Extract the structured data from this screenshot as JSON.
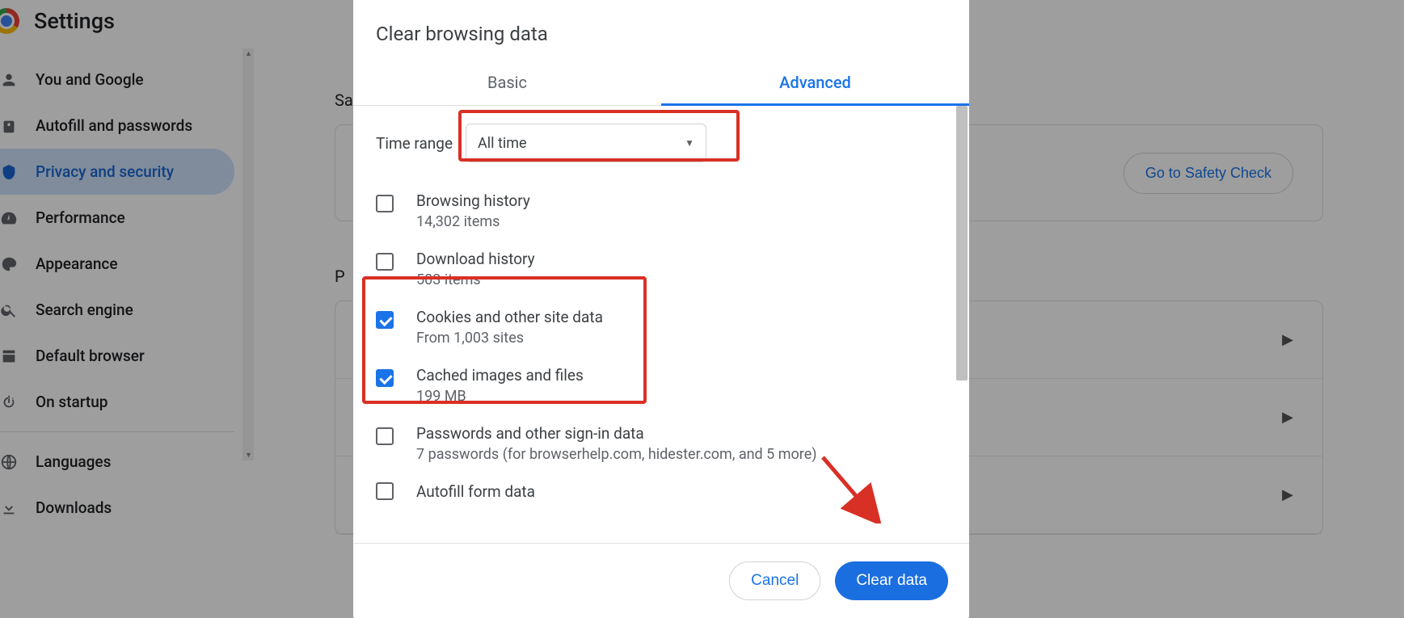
{
  "settings_title": "Settings",
  "sidebar": {
    "items": [
      {
        "icon": "person",
        "label": "You and Google"
      },
      {
        "icon": "key",
        "label": "Autofill and passwords"
      },
      {
        "icon": "shield",
        "label": "Privacy and security"
      },
      {
        "icon": "speed",
        "label": "Performance"
      },
      {
        "icon": "palette",
        "label": "Appearance"
      },
      {
        "icon": "search",
        "label": "Search engine"
      },
      {
        "icon": "window",
        "label": "Default browser"
      },
      {
        "icon": "power",
        "label": "On startup"
      },
      {
        "icon": "globe",
        "label": "Languages"
      },
      {
        "icon": "download",
        "label": "Downloads"
      }
    ],
    "active_index": 2
  },
  "bg": {
    "section1": "Sa",
    "safety_button": "Go to Safety Check",
    "section2": "P"
  },
  "dialog": {
    "title": "Clear browsing data",
    "tabs": [
      "Basic",
      "Advanced"
    ],
    "active_tab": 1,
    "time_label": "Time range",
    "time_value": "All time",
    "options": [
      {
        "title": "Browsing history",
        "sub": "14,302 items",
        "checked": false
      },
      {
        "title": "Download history",
        "sub": "503 items",
        "checked": false
      },
      {
        "title": "Cookies and other site data",
        "sub": "From 1,003 sites",
        "checked": true
      },
      {
        "title": "Cached images and files",
        "sub": "199 MB",
        "checked": true
      },
      {
        "title": "Passwords and other sign-in data",
        "sub": "7 passwords (for browserhelp.com, hidester.com, and 5 more)",
        "checked": false
      },
      {
        "title": "Autofill form data",
        "sub": "",
        "checked": false
      }
    ],
    "cancel": "Cancel",
    "confirm": "Clear data"
  }
}
